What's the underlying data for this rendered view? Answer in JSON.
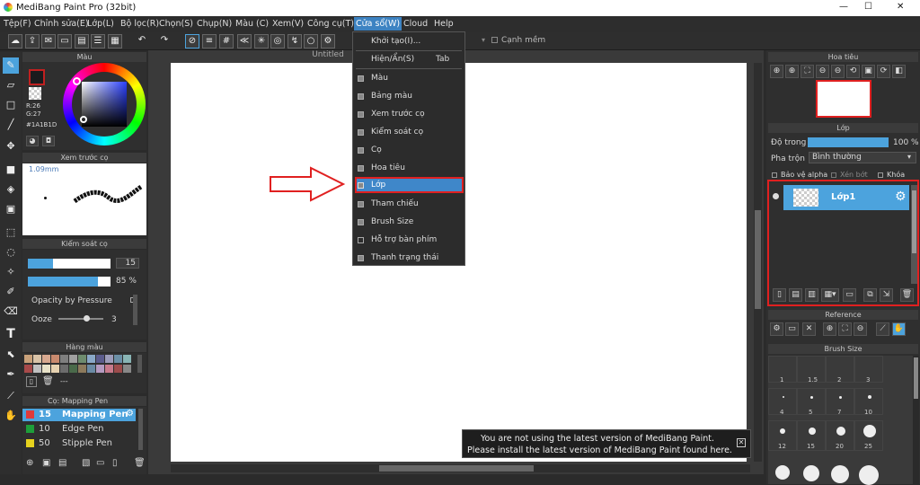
{
  "window": {
    "title": "MediBang Paint Pro (32bit)",
    "min": "—",
    "max": "☐",
    "close": "✕"
  },
  "menu": [
    "Tệp(F)",
    "Chỉnh sửa(E)",
    "Lớp(L)",
    "Bộ lọc(R)",
    "Chọn(S)",
    "Chụp(N)",
    "Màu (C)",
    "Xem(V)",
    "Công cụ(T)",
    "Cửa sổ(W)",
    "Cloud",
    "Help"
  ],
  "toolbar": {
    "antialias": "Cạnh mềm"
  },
  "canvas": {
    "tab": "Untitled"
  },
  "color_panel": {
    "title": "Màu",
    "r": "R:26",
    "g": "G:27",
    "hex": "#1A1B1D",
    "primary": "#1a1b1d"
  },
  "preview_panel": {
    "title": "Xem trước cọ",
    "size": "1.09mm"
  },
  "brush_control": {
    "title": "Kiểm soát cọ",
    "size_value": "15",
    "opacity_value": "85 %",
    "opacity_pressure": "Opacity by Pressure",
    "ooze_label": "Ooze",
    "ooze_value": "3"
  },
  "swatch_panel": {
    "title": "Hàng màu",
    "more": "---",
    "colors": [
      "#c9a17a",
      "#d9c3a7",
      "#d7a88f",
      "#c98a6e",
      "#7f7f7f",
      "#a0a0a0",
      "#6e8c6e",
      "#8aa8c8",
      "#5b5b8c",
      "#9c9cba",
      "#6b8fa6",
      "#88b4b4",
      "#a84a4a",
      "#c0c0c0",
      "#e8e2c8",
      "#e6d2b0",
      "#6c6c6c",
      "#4a6a4a",
      "#8c7a5c",
      "#6a8aa4",
      "#b49ac0",
      "#c87a8c",
      "#9c4c4c",
      "#888888"
    ]
  },
  "brush_list": {
    "title": "Cọ: Mapping Pen",
    "items": [
      {
        "num": "15",
        "name": "Mapping Pen",
        "color": "#e03a3a"
      },
      {
        "num": "10",
        "name": "Edge Pen",
        "color": "#1e9e3a"
      },
      {
        "num": "50",
        "name": "Stipple Pen",
        "color": "#e6d21e"
      }
    ]
  },
  "window_menu": {
    "items": [
      {
        "label": "Khởi tạo(I)...",
        "shortcut": "",
        "check": false
      },
      {
        "label": "Hiện/Ẩn(S)",
        "shortcut": "Tab",
        "check": false
      },
      {
        "label": "Màu",
        "shortcut": "",
        "check": true
      },
      {
        "label": "Bảng màu",
        "shortcut": "",
        "check": true
      },
      {
        "label": "Xem trước cọ",
        "shortcut": "",
        "check": true
      },
      {
        "label": "Kiểm soát cọ",
        "shortcut": "",
        "check": true
      },
      {
        "label": "Cọ",
        "shortcut": "",
        "check": true
      },
      {
        "label": "Hoa tiêu",
        "shortcut": "",
        "check": true
      },
      {
        "label": "Lớp",
        "shortcut": "",
        "check": true
      },
      {
        "label": "Tham chiếu",
        "shortcut": "",
        "check": true
      },
      {
        "label": "Brush Size",
        "shortcut": "",
        "check": true
      },
      {
        "label": "Hỗ trợ bàn phím",
        "shortcut": "",
        "check": false
      },
      {
        "label": "Thanh trạng thái",
        "shortcut": "",
        "check": true
      }
    ],
    "highlighted": "Lớp"
  },
  "navigator": {
    "title": "Hoa tiêu"
  },
  "layer_panel": {
    "title": "Lớp",
    "opacity_label": "Độ trong",
    "opacity_value": "100 %",
    "blend_label": "Pha trộn",
    "blend_value": "Bình thường",
    "protect_alpha": "Bảo vệ alpha",
    "clip": "Xén bớt",
    "lock": "Khóa",
    "layer_name": "Lớp1"
  },
  "reference": {
    "title": "Reference"
  },
  "brush_size": {
    "title": "Brush Size",
    "labels": [
      "1",
      "1.5",
      "2",
      "3",
      "4",
      "5",
      "7",
      "10",
      "12",
      "15",
      "20",
      "25"
    ]
  },
  "notice": {
    "line1": "You are not using the latest version of MediBang Paint.",
    "line2": "Please install the latest version of MediBang Paint found here."
  },
  "accent": "#4ca3dd",
  "highlight_color": "#e02020"
}
